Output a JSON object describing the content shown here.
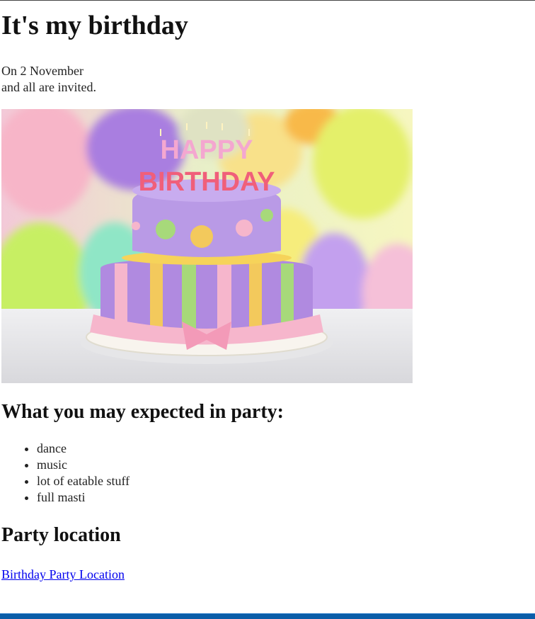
{
  "page": {
    "title": "It's my birthday",
    "intro_line1": "On 2 November",
    "intro_line2": "and all are invited.",
    "image": {
      "cake_topper_line1": "HAPPY",
      "cake_topper_line2": "BIRTHDAY"
    },
    "expect_heading": "What you may expected in party:",
    "expect_items": [
      "dance",
      "music",
      "lot of eatable stuff",
      "full masti"
    ],
    "location_heading": "Party location",
    "location_link": "Birthday Party Location"
  },
  "colors": {
    "link": "#0000ee",
    "taskbar": "#0a5da8"
  }
}
